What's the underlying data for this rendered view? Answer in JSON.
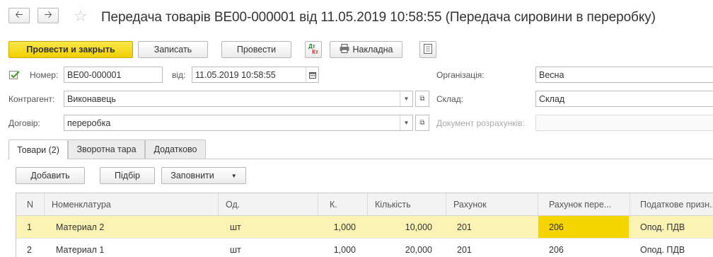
{
  "header": {
    "back_icon": "arrow-left",
    "forward_icon": "arrow-right",
    "star_icon": "star-outline",
    "title": "Передача товарів ВЕ00-000001 від 11.05.2019 10:58:55 (Передача сировини в переробку)"
  },
  "toolbar": {
    "post_close": "Провести и закрыть",
    "save": "Записать",
    "post": "Провести",
    "dtkt_dt": "Дт",
    "dtkt_kt": "Кт",
    "invoice": "Накладна",
    "print_icon": "printer",
    "report_icon": "document"
  },
  "form": {
    "number_label": "Номер:",
    "number_value": "ВЕ00-000001",
    "date_label": "від:",
    "date_value": "11.05.2019 10:58:55",
    "org_label": "Організація:",
    "org_value": "Весна",
    "contractor_label": "Контрагент:",
    "contractor_value": "Виконавець",
    "warehouse_label": "Склад:",
    "warehouse_value": "Склад",
    "contract_label": "Договір:",
    "contract_value": "переробка",
    "settlement_label": "Документ розрахунків:",
    "settlement_value": ""
  },
  "tabs": [
    {
      "label": "Товари (2)",
      "active": true
    },
    {
      "label": "Зворотна тара",
      "active": false
    },
    {
      "label": "Додатково",
      "active": false
    }
  ],
  "table_toolbar": {
    "add": "Добавить",
    "select": "Підбір",
    "fill": "Заповнити"
  },
  "table": {
    "columns": [
      "N",
      "Номенклатура",
      "Од.",
      "К.",
      "Кількість",
      "Рахунок",
      "Рахунок пере...",
      "Податкове призн..."
    ],
    "rows": [
      [
        "1",
        "Материал 2",
        "шт",
        "1,000",
        "10,000",
        "201",
        "206",
        "Опод. ПДВ"
      ],
      [
        "2",
        "Материал 1",
        "шт",
        "1,000",
        "20,000",
        "201",
        "206",
        "Опод. ПДВ"
      ]
    ]
  },
  "colors": {
    "primary_button": "#f5d400",
    "selected_row": "#fbf3b4",
    "selected_cell": "#f5d400"
  }
}
